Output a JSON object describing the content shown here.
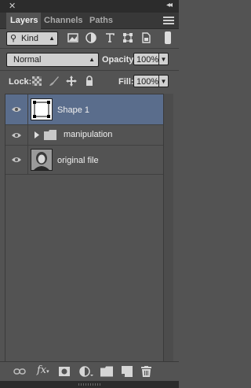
{
  "window": {
    "close_glyph": "✕",
    "collapse_glyph": "◂◂"
  },
  "tabs": [
    {
      "label": "Layers",
      "active": true
    },
    {
      "label": "Channels",
      "active": false
    },
    {
      "label": "Paths",
      "active": false
    }
  ],
  "filter": {
    "kind_label": "Kind",
    "icons": [
      "pixel-layer-filter-icon",
      "adjustment-layer-filter-icon",
      "type-layer-filter-icon",
      "shape-layer-filter-icon",
      "smart-object-filter-icon"
    ]
  },
  "blend": {
    "mode": "Normal",
    "opacity_label": "Opacity:",
    "opacity_value": "100%"
  },
  "lock": {
    "label": "Lock:",
    "fill_label": "Fill:",
    "fill_value": "100%",
    "icons": [
      "lock-transparent-pixels-icon",
      "lock-image-pixels-icon",
      "lock-position-icon",
      "lock-all-icon"
    ]
  },
  "layers": [
    {
      "name": "Shape 1",
      "type": "shape",
      "selected": true,
      "visible": true
    },
    {
      "name": "manipulation",
      "type": "group",
      "selected": false,
      "visible": true
    },
    {
      "name": "original file",
      "type": "image",
      "selected": false,
      "visible": true
    }
  ],
  "bottom_icons": [
    "link-layers-icon",
    "fx-icon",
    "add-mask-icon",
    "adjustment-layer-icon",
    "new-group-icon",
    "new-layer-icon",
    "trash-icon"
  ],
  "colors": {
    "panel": "#535353",
    "selected_row": "#5a6d8c",
    "tab_bar": "#383838"
  }
}
